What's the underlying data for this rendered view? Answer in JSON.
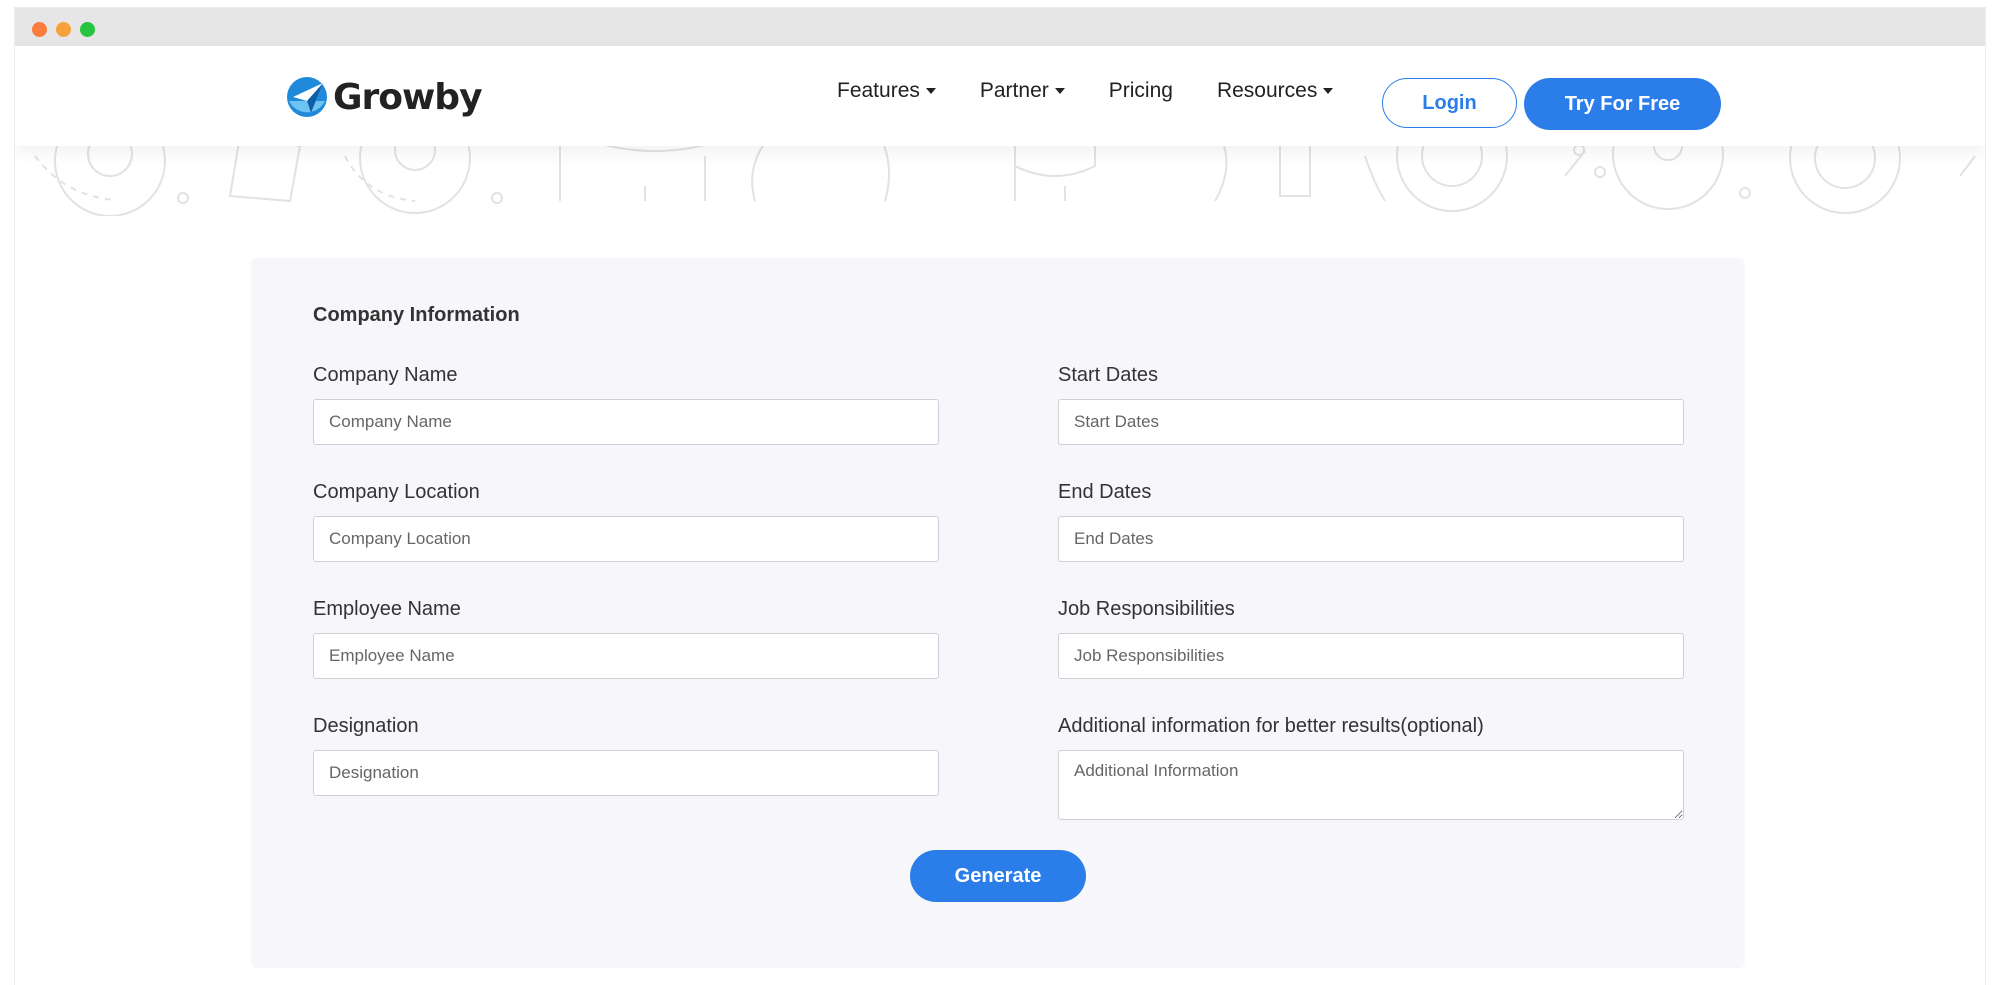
{
  "brand": {
    "name": "Growby",
    "accent_color": "#2b7de9"
  },
  "nav": {
    "items": [
      {
        "label": "Features",
        "dropdown": true
      },
      {
        "label": "Partner",
        "dropdown": true
      },
      {
        "label": "Pricing",
        "dropdown": false
      },
      {
        "label": "Resources",
        "dropdown": true
      }
    ],
    "login_label": "Login",
    "try_label": "Try For Free"
  },
  "form": {
    "section_title": "Company Information",
    "left_fields": [
      {
        "label": "Company Name",
        "placeholder": "Company Name"
      },
      {
        "label": "Company Location",
        "placeholder": "Company Location"
      },
      {
        "label": "Employee Name",
        "placeholder": "Employee Name"
      },
      {
        "label": "Designation",
        "placeholder": "Designation"
      }
    ],
    "right_fields": [
      {
        "label": "Start Dates",
        "placeholder": "Start Dates"
      },
      {
        "label": "End Dates",
        "placeholder": "End Dates"
      },
      {
        "label": "Job Responsibilities",
        "placeholder": "Job Responsibilities"
      },
      {
        "label": "Additional information for better results(optional)",
        "placeholder": "Additional Information"
      }
    ],
    "generate_label": "Generate"
  }
}
